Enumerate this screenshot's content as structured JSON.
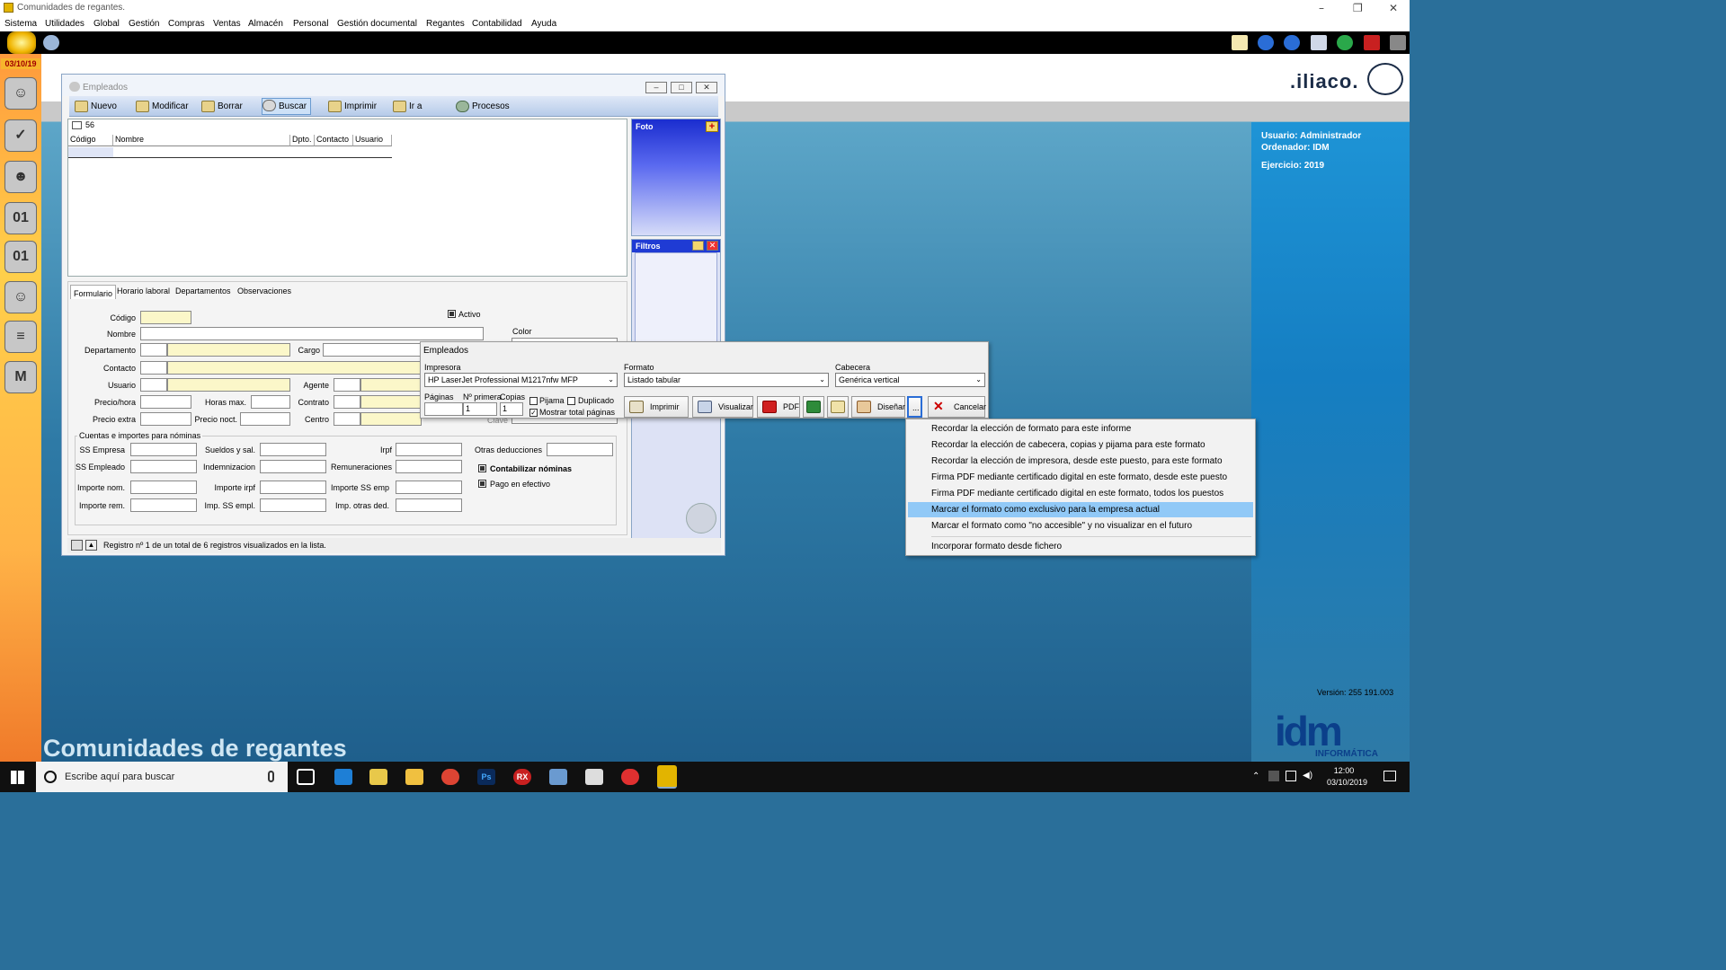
{
  "app": {
    "title": "Comunidades de regantes.",
    "bottom_title": "Comunidades de regantes"
  },
  "menu": [
    "Sistema",
    "Utilidades",
    "Global",
    "Gestión",
    "Compras",
    "Ventas",
    "Almacén",
    "Personal",
    "Gestión documental",
    "Regantes",
    "Contabilidad",
    "Ayuda"
  ],
  "sidebar": {
    "date": "03/10/19"
  },
  "brand": {
    "logo": ".iliaco.",
    "idm": "idm",
    "idm_sub": "INFORMÁTICA",
    "version": "Versión: 255 191.003"
  },
  "user_panel": {
    "usuario": "Usuario: Administrador",
    "ordenador": "Ordenador:  IDM",
    "ejercicio": "Ejercicio: 2019"
  },
  "window": {
    "title": "Empleados",
    "toolbar": [
      "Nuevo",
      "Modificar",
      "Borrar",
      "Buscar",
      "Imprimir",
      "Ir a",
      "Procesos"
    ],
    "grid": {
      "count": "56",
      "columns": [
        "Código",
        "Nombre",
        "Dpto.",
        "Contacto",
        "Usuario"
      ]
    },
    "foto_label": "Foto",
    "filtros_label": "Filtros",
    "tabs": [
      "Formulario",
      "Horario laboral",
      "Departamentos",
      "Observaciones"
    ],
    "form": {
      "codigo": "Código",
      "nombre": "Nombre",
      "departamento": "Departamento",
      "cargo": "Cargo",
      "contacto": "Contacto",
      "usuario": "Usuario",
      "agente": "Agente",
      "precio_hora": "Precio/hora",
      "horas_max": "Horas max.",
      "contrato": "Contrato",
      "precio_extra": "Precio extra",
      "precio_noct": "Precio noct.",
      "centro": "Centro",
      "activo": "Activo",
      "color": "Color",
      "clave": "Clave",
      "group": "Cuentas e importes para nóminas",
      "ss_empresa": "SS Empresa",
      "sueldos": "Sueldos y sal.",
      "irpf": "Irpf",
      "otras_deducciones": "Otras deducciones",
      "ss_empleado": "SS Empleado",
      "indemnizacion": "Indemnizacion",
      "remuneraciones": "Remuneraciones",
      "importe_nom": "Importe nom.",
      "importe_irpf": "Importe irpf",
      "importe_ss_emp": "Importe SS emp",
      "importe_rem": "Importe rem.",
      "imp_ss_empl": "Imp. SS empl.",
      "imp_otras_ded": "Imp. otras ded.",
      "contabilizar": "Contabilizar nóminas",
      "pago_efectivo": "Pago en efectivo"
    },
    "status": "Registro nº 1 de un total de 6 registros visualizados en la lista."
  },
  "print_dialog": {
    "title": "Empleados",
    "impresora_label": "Impresora",
    "impresora_value": "HP LaserJet Professional M1217nfw MFP",
    "formato_label": "Formato",
    "formato_value": "Listado tabular",
    "cabecera_label": "Cabecera",
    "cabecera_value": "Genérica vertical",
    "paginas_label": "Páginas",
    "primera_label": "Nº primera",
    "copias_label": "Copias",
    "primera_value": "1",
    "copias_value": "1",
    "pijama": "Pijama",
    "duplicado": "Duplicado",
    "mostrar_total": "Mostrar total páginas",
    "buttons": {
      "imprimir": "Imprimir",
      "visualizar": "Visualizar",
      "pdf": "PDF",
      "disenar": "Diseñar",
      "more": "...",
      "cancelar": "Cancelar"
    }
  },
  "context_menu": [
    "Recordar la elección de formato para este informe",
    "Recordar la elección de cabecera, copias y pijama para este formato",
    "Recordar la elección de impresora, desde este puesto, para este formato",
    "Firma PDF mediante certificado digital en este formato, desde este puesto",
    "Firma PDF mediante certificado digital en este formato, todos los puestos",
    "Marcar el formato como exclusivo para la empresa actual",
    "Marcar el formato como \"no accesible\" y no visualizar en el futuro",
    "Incorporar formato desde fichero"
  ],
  "taskbar": {
    "search": "Escribe aquí para buscar",
    "time": "12:00",
    "date": "03/10/2019"
  },
  "colors": {
    "accent": "#1e94d6",
    "highlight": "#91c9f7",
    "taskbar": "#101010"
  }
}
